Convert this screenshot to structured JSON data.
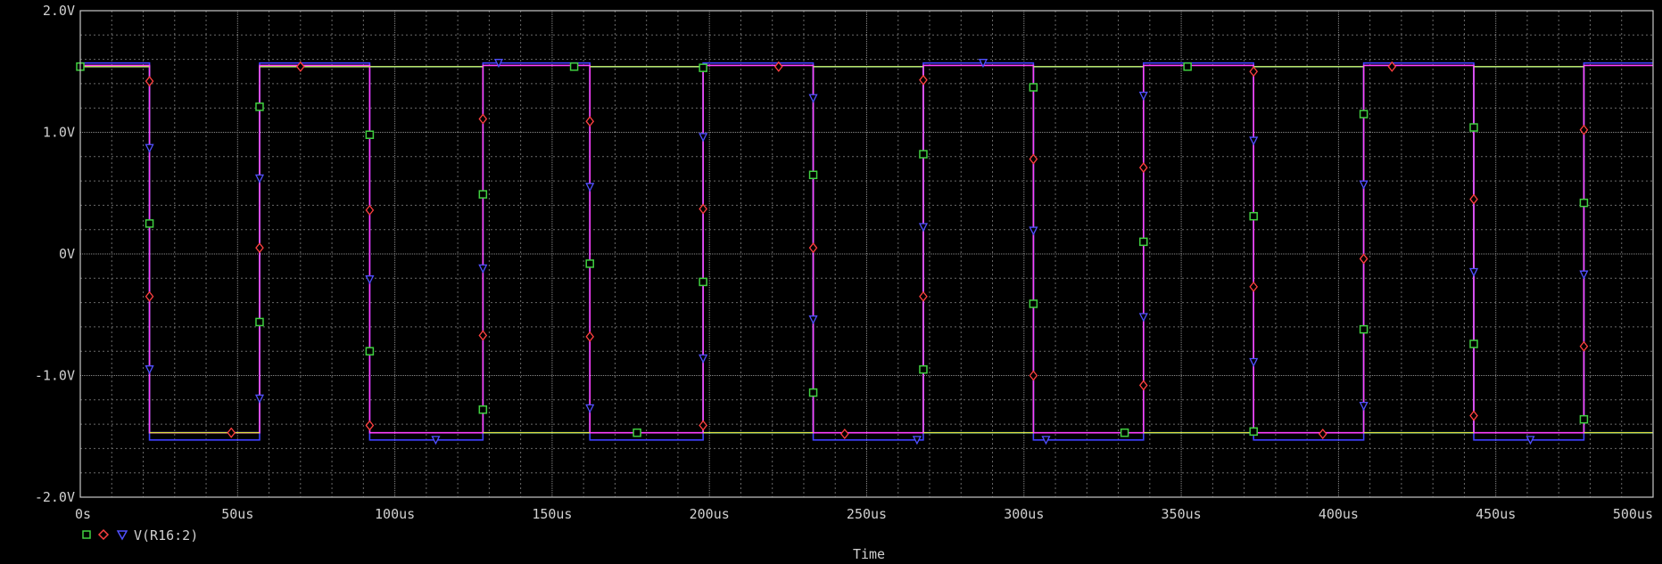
{
  "chart_data": {
    "type": "line",
    "xlabel": "Time",
    "ylabel": "",
    "xlim": [
      0,
      500
    ],
    "ylim": [
      -2,
      2
    ],
    "x_ticks": [
      0,
      50,
      100,
      150,
      200,
      250,
      300,
      350,
      400,
      450,
      500
    ],
    "x_tick_labels": [
      "0s",
      "50us",
      "100us",
      "150us",
      "200us",
      "250us",
      "300us",
      "350us",
      "400us",
      "450us",
      "500us"
    ],
    "y_ticks": [
      2,
      1,
      0,
      -1,
      -2
    ],
    "y_tick_labels": [
      "2.0V",
      "1.0V",
      "0V",
      "-1.0V",
      "-2.0V"
    ],
    "grid": true,
    "legend_text": "V(R16:2)",
    "legend_position": "bottom-left",
    "series": [
      {
        "marker": "square",
        "color": "#40d040",
        "line_color": "#40e0e0",
        "high": 1.54,
        "low": -1.47,
        "transitions": [
          22,
          57,
          128,
          162,
          198,
          233,
          268,
          303,
          338,
          373,
          408,
          443,
          478
        ],
        "marker_points": [
          [
            0,
            1.54
          ],
          [
            22,
            0.25
          ],
          [
            57,
            1.21
          ],
          [
            57,
            -0.56
          ],
          [
            92,
            0.98
          ],
          [
            92,
            -0.8
          ],
          [
            128,
            0.49
          ],
          [
            128,
            -1.28
          ],
          [
            157,
            1.54
          ],
          [
            162,
            -0.08
          ],
          [
            177,
            -1.47
          ],
          [
            198,
            1.53
          ],
          [
            198,
            -0.23
          ],
          [
            233,
            0.65
          ],
          [
            233,
            -1.14
          ],
          [
            268,
            0.82
          ],
          [
            268,
            -0.95
          ],
          [
            303,
            1.37
          ],
          [
            303,
            -0.41
          ],
          [
            332,
            -1.47
          ],
          [
            338,
            0.1
          ],
          [
            352,
            1.54
          ],
          [
            373,
            0.31
          ],
          [
            373,
            -1.46
          ],
          [
            408,
            1.15
          ],
          [
            408,
            -0.62
          ],
          [
            443,
            1.04
          ],
          [
            443,
            -0.74
          ],
          [
            478,
            0.42
          ],
          [
            478,
            -1.36
          ]
        ]
      },
      {
        "marker": "diamond",
        "color": "#ff4040",
        "line_color": "#ff40ff",
        "high": 1.55,
        "low": -1.47,
        "transitions": [
          22,
          57,
          92,
          128,
          162,
          198,
          233,
          268,
          303,
          338,
          373,
          408,
          443,
          478
        ],
        "marker_points": [
          [
            22,
            1.42
          ],
          [
            22,
            -0.35
          ],
          [
            48,
            -1.47
          ],
          [
            57,
            0.05
          ],
          [
            70,
            1.54
          ],
          [
            92,
            0.36
          ],
          [
            92,
            -1.41
          ],
          [
            128,
            1.11
          ],
          [
            128,
            -0.67
          ],
          [
            162,
            1.09
          ],
          [
            162,
            -0.68
          ],
          [
            198,
            0.37
          ],
          [
            198,
            -1.41
          ],
          [
            222,
            1.54
          ],
          [
            233,
            0.05
          ],
          [
            243,
            -1.48
          ],
          [
            268,
            1.43
          ],
          [
            268,
            -0.35
          ],
          [
            303,
            0.78
          ],
          [
            303,
            -1.0
          ],
          [
            338,
            0.71
          ],
          [
            338,
            -1.08
          ],
          [
            373,
            1.5
          ],
          [
            373,
            -0.27
          ],
          [
            395,
            -1.48
          ],
          [
            408,
            -0.04
          ],
          [
            417,
            1.54
          ],
          [
            443,
            0.45
          ],
          [
            443,
            -1.33
          ],
          [
            478,
            1.02
          ],
          [
            478,
            -0.76
          ]
        ]
      },
      {
        "marker": "triangle",
        "color": "#5050ff",
        "line_color": "#4040ff",
        "high": 1.57,
        "low": -1.53,
        "transitions": [
          22,
          57,
          92,
          128,
          162,
          198,
          233,
          268,
          303,
          338,
          373,
          408,
          443,
          478
        ],
        "marker_points": [
          [
            22,
            0.87
          ],
          [
            22,
            -0.95
          ],
          [
            57,
            0.62
          ],
          [
            57,
            -1.19
          ],
          [
            92,
            -0.21
          ],
          [
            113,
            -1.53
          ],
          [
            128,
            -0.12
          ],
          [
            133,
            1.57
          ],
          [
            162,
            0.55
          ],
          [
            162,
            -1.27
          ],
          [
            198,
            0.96
          ],
          [
            198,
            -0.86
          ],
          [
            233,
            1.28
          ],
          [
            233,
            -0.54
          ],
          [
            266,
            -1.53
          ],
          [
            268,
            0.22
          ],
          [
            287,
            1.57
          ],
          [
            303,
            0.19
          ],
          [
            307,
            -1.53
          ],
          [
            338,
            1.3
          ],
          [
            338,
            -0.52
          ],
          [
            373,
            0.93
          ],
          [
            373,
            -0.89
          ],
          [
            408,
            0.57
          ],
          [
            408,
            -1.25
          ],
          [
            443,
            -0.15
          ],
          [
            461,
            -1.53
          ],
          [
            478,
            -0.17
          ]
        ]
      }
    ]
  }
}
